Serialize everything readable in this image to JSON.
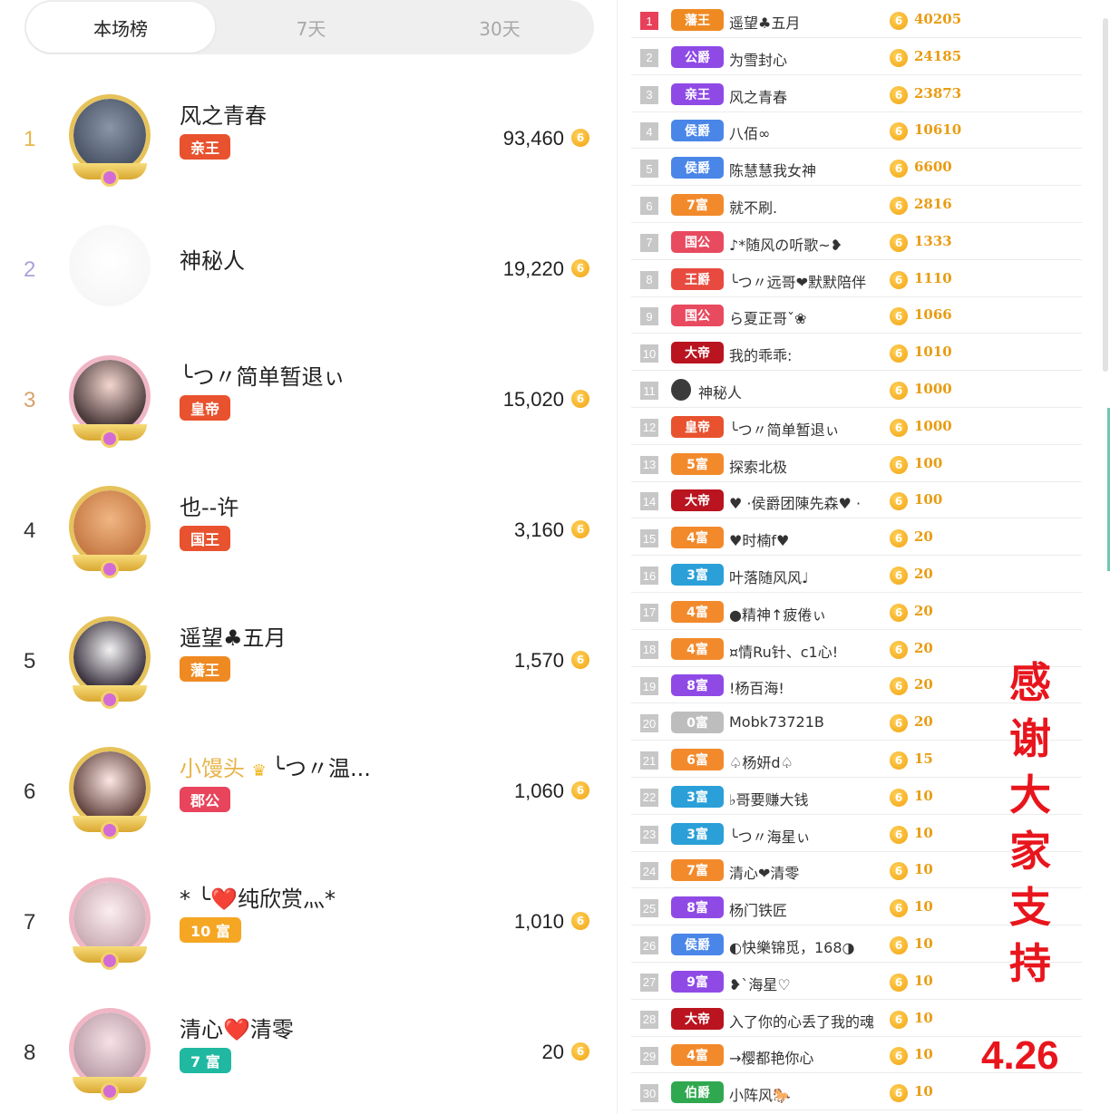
{
  "tabs": [
    "本场榜",
    "7天",
    "30天"
  ],
  "leaderboard": [
    {
      "rank": "1",
      "name": "风之青春",
      "badge": "亲王",
      "score": "93,460",
      "rank_color": "#e8b64a",
      "badge_color": "#e8522e"
    },
    {
      "rank": "2",
      "name": "神秘人",
      "badge": "",
      "score": "19,220",
      "rank_color": "#a8a4d8",
      "badge_color": ""
    },
    {
      "rank": "3",
      "name": "╰つ〃简单暂退ぃ",
      "badge": "皇帝",
      "score": "15,020",
      "rank_color": "#d7a26a",
      "badge_color": "#e8522e"
    },
    {
      "rank": "4",
      "name": "也--许",
      "badge": "国王",
      "score": "3,160",
      "rank_color": "#333333",
      "badge_color": "#e8522e"
    },
    {
      "rank": "5",
      "name": "遥望♣五月",
      "badge": "藩王",
      "score": "1,570",
      "rank_color": "#333333",
      "badge_color": "#ef8a22"
    },
    {
      "rank": "6",
      "name_gold": "小馒头",
      "name": "╰つ〃温...",
      "badge": "郡公",
      "score": "1,060",
      "rank_color": "#333333",
      "badge_color": "#e8445c"
    },
    {
      "rank": "7",
      "name": "* ╰❤️纯欣赏灬*",
      "badge": "10 富",
      "score": "1,010",
      "rank_color": "#333333",
      "badge_color": "#f5a623"
    },
    {
      "rank": "8",
      "name": "清心❤️清零",
      "badge": "7 富",
      "score": "20",
      "rank_color": "#333333",
      "badge_color": "#21b8a2"
    }
  ],
  "coin_glyph": "6",
  "rankings": [
    {
      "num": "1",
      "badge": "藩王",
      "name": "遥望♣五月",
      "score": "40205",
      "color": "#ef8a22"
    },
    {
      "num": "2",
      "badge": "公爵",
      "name": "为雪封心",
      "score": "24185",
      "color": "#8f4ae6"
    },
    {
      "num": "3",
      "badge": "亲王",
      "name": "风之青春",
      "score": "23873",
      "color": "#8f4ae6"
    },
    {
      "num": "4",
      "badge": "侯爵",
      "name": "八佰∞",
      "score": "10610",
      "color": "#4a86e8"
    },
    {
      "num": "5",
      "badge": "侯爵",
      "name": "陈慧慧我女神",
      "score": "6600",
      "color": "#4a86e8"
    },
    {
      "num": "6",
      "badge": "7富",
      "name": "就不刷.",
      "score": "2816",
      "color": "#f28a2c"
    },
    {
      "num": "7",
      "badge": "国公",
      "name": "♪*随风の听歌~❥",
      "score": "1333",
      "color": "#e84a5f"
    },
    {
      "num": "8",
      "badge": "王爵",
      "name": "╰つ〃远哥❤默默陪伴",
      "score": "1110",
      "color": "#e84a3f"
    },
    {
      "num": "9",
      "badge": "国公",
      "name": "ら夏正哥ˇ❀",
      "score": "1066",
      "color": "#e84a5f"
    },
    {
      "num": "10",
      "badge": "大帝",
      "name": "我的乖乖:",
      "score": "1010",
      "color": "#b9141f"
    },
    {
      "num": "11",
      "badge": "",
      "name": "神秘人",
      "score": "1000",
      "color": ""
    },
    {
      "num": "12",
      "badge": "皇帝",
      "name": "╰つ〃简单暂退ぃ",
      "score": "1000",
      "color": "#e8522e"
    },
    {
      "num": "13",
      "badge": "5富",
      "name": "探索北极",
      "score": "100",
      "color": "#f28a2c"
    },
    {
      "num": "14",
      "badge": "大帝",
      "name": "♥ ·侯爵团陳先森♥ ·",
      "score": "100",
      "color": "#b9141f"
    },
    {
      "num": "15",
      "badge": "4富",
      "name": "♥时楠f♥",
      "score": "20",
      "color": "#f28a2c"
    },
    {
      "num": "16",
      "badge": "3富",
      "name": "叶落随风风♩",
      "score": "20",
      "color": "#2a9fd8"
    },
    {
      "num": "17",
      "badge": "4富",
      "name": "●精神↑疲倦ぃ",
      "score": "20",
      "color": "#f28a2c"
    },
    {
      "num": "18",
      "badge": "4富",
      "name": "¤情Ru针、c1心!",
      "score": "20",
      "color": "#f28a2c"
    },
    {
      "num": "19",
      "badge": "8富",
      "name": "!杨百海!",
      "score": "20",
      "color": "#8f4ae6"
    },
    {
      "num": "20",
      "badge": "0富",
      "name": "Mobk73721B",
      "score": "20",
      "color": "#bdbdbd"
    },
    {
      "num": "21",
      "badge": "6富",
      "name": "♤杨妍d♤",
      "score": "15",
      "color": "#f28a2c"
    },
    {
      "num": "22",
      "badge": "3富",
      "name": "♭哥要赚大钱",
      "score": "10",
      "color": "#2a9fd8"
    },
    {
      "num": "23",
      "badge": "3富",
      "name": "╰つ〃海星ぃ",
      "score": "10",
      "color": "#2a9fd8"
    },
    {
      "num": "24",
      "badge": "7富",
      "name": "清心❤清零",
      "score": "10",
      "color": "#f28a2c"
    },
    {
      "num": "25",
      "badge": "8富",
      "name": "杨门铁匠",
      "score": "10",
      "color": "#8f4ae6"
    },
    {
      "num": "26",
      "badge": "侯爵",
      "name": "◐快樂锦觅，168◑",
      "score": "10",
      "color": "#4a86e8"
    },
    {
      "num": "27",
      "badge": "9富",
      "name": "❥`海星♡",
      "score": "10",
      "color": "#8f4ae6"
    },
    {
      "num": "28",
      "badge": "大帝",
      "name": "入了你的心丢了我的魂",
      "score": "10",
      "color": "#b9141f"
    },
    {
      "num": "29",
      "badge": "4富",
      "name": "→樱都艳你心",
      "score": "10",
      "color": "#f28a2c"
    },
    {
      "num": "30",
      "badge": "伯爵",
      "name": "小阵风🐎",
      "score": "10",
      "color": "#2fa84f"
    }
  ],
  "overlay": {
    "thanks": [
      "感",
      "谢",
      "大",
      "家",
      "支",
      "持"
    ],
    "date": "4.26"
  }
}
